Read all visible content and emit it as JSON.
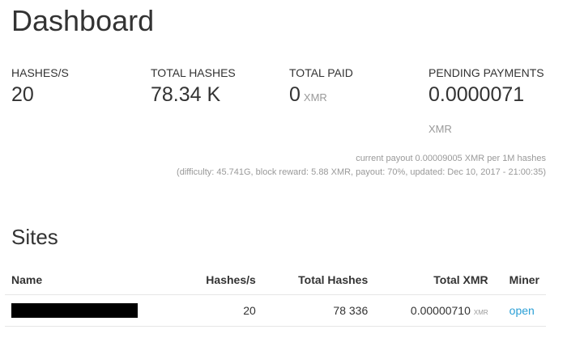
{
  "page": {
    "title": "Dashboard"
  },
  "stats": {
    "hashes_per_sec": {
      "label": "HASHES/S",
      "value": "20"
    },
    "total_hashes": {
      "label": "TOTAL HASHES",
      "value": "78.34 K"
    },
    "total_paid": {
      "label": "TOTAL PAID",
      "value": "0",
      "unit": "XMR"
    },
    "pending_payments": {
      "label": "PENDING PAYMENTS",
      "value": "0.0000071",
      "unit": "XMR"
    }
  },
  "payout": {
    "line1": "current payout 0.00009005 XMR per 1M hashes",
    "line2": "(difficulty: 45.741G, block reward: 5.88 XMR, payout: 70%, updated: Dec 10, 2017 - 21:00:35)"
  },
  "sites": {
    "title": "Sites",
    "columns": {
      "name": "Name",
      "hashes_per_sec": "Hashes/s",
      "total_hashes": "Total Hashes",
      "total_xmr": "Total XMR",
      "miner": "Miner"
    },
    "rows": [
      {
        "name_redacted": true,
        "hashes_per_sec": "20",
        "total_hashes": "78 336",
        "total_xmr": "0.00000710",
        "xmr_unit": "XMR",
        "miner_link": "open"
      }
    ]
  },
  "colors": {
    "link": "#2a9fd6",
    "muted": "#999999",
    "text": "#333333"
  }
}
